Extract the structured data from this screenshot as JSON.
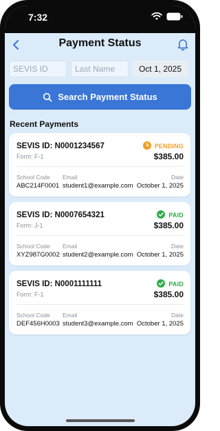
{
  "status_bar": {
    "time": "7:32"
  },
  "nav": {
    "title": "Payment Status"
  },
  "filters": {
    "sevis_placeholder": "SEVIS ID",
    "last_name_placeholder": "Last Name",
    "date": "Oct 1, 2025"
  },
  "search_button": {
    "label": "Search Payment Status"
  },
  "recent": {
    "title": "Recent Payments",
    "field_labels": {
      "school": "School Code",
      "email": "Email",
      "date": "Date"
    },
    "items": [
      {
        "sevis": "SEVIS ID: N0001234567",
        "form": "Form: F-1",
        "status": "PENDING",
        "status_color": "#f0a02a",
        "amount": "$385.00",
        "school": "ABC214F0001",
        "email": "student1@example.com",
        "date": "October 1, 2025"
      },
      {
        "sevis": "SEVIS ID: N0007654321",
        "form": "Form: J-1",
        "status": "PAID",
        "status_color": "#2fae4a",
        "amount": "$385.00",
        "school": "XYZ987G0002",
        "email": "student2@example.com",
        "date": "October 1, 2025"
      },
      {
        "sevis": "SEVIS ID: N0001111111",
        "form": "Form: F-1",
        "status": "PAID",
        "status_color": "#2fae4a",
        "amount": "$385.00",
        "school": "DEF456H0003",
        "email": "student3@example.com",
        "date": "October 1, 2025"
      }
    ]
  },
  "colors": {
    "accent": "#3a76d6",
    "background": "#dcebf9",
    "pending": "#f0a02a",
    "paid": "#2fae4a"
  }
}
